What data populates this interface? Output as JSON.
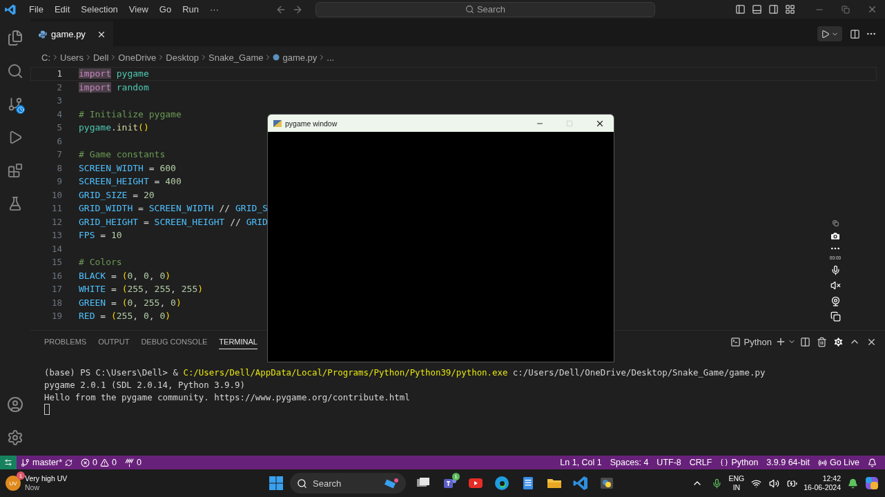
{
  "title_bar": {
    "menu": [
      "File",
      "Edit",
      "Selection",
      "View",
      "Go",
      "Run",
      "···"
    ],
    "search": {
      "placeholder": "Search"
    }
  },
  "editor_tabs": [
    {
      "label": "game.py",
      "selected": true
    }
  ],
  "breadcrumbs": [
    {
      "kind": "folder",
      "label": "C:"
    },
    {
      "kind": "folder",
      "label": "Users"
    },
    {
      "kind": "folder",
      "label": "Dell"
    },
    {
      "kind": "folder",
      "label": "OneDrive"
    },
    {
      "kind": "folder",
      "label": "Desktop"
    },
    {
      "kind": "folder",
      "label": "Snake_Game"
    },
    {
      "kind": "file",
      "label": "game.py"
    },
    {
      "kind": "more",
      "label": "..."
    }
  ],
  "code_lines": [
    {
      "number": "1",
      "current": true,
      "tokens": [
        {
          "kind": "keyword-match",
          "text": "import"
        },
        {
          "kind": "module",
          "text": " pygame"
        }
      ]
    },
    {
      "number": "2",
      "current": false,
      "tokens": [
        {
          "kind": "keyword-match",
          "text": "import"
        },
        {
          "kind": "module",
          "text": " random"
        }
      ]
    },
    {
      "number": "3",
      "current": false
    },
    {
      "number": "4",
      "current": false,
      "tokens": [
        {
          "kind": "comment",
          "text": "# Initialize pygame"
        }
      ]
    },
    {
      "number": "5",
      "current": false,
      "tokens": [
        {
          "kind": "module",
          "text": "pygame"
        },
        {
          "kind": "plain",
          "text": "."
        },
        {
          "kind": "function",
          "text": "init"
        },
        {
          "kind": "paren",
          "text": "()"
        }
      ]
    },
    {
      "number": "6",
      "current": false
    },
    {
      "number": "7",
      "current": false,
      "tokens": [
        {
          "kind": "comment",
          "text": "# Game constants"
        }
      ]
    },
    {
      "number": "8",
      "current": false,
      "tokens": [
        {
          "kind": "constant",
          "text": "SCREEN_WIDTH"
        },
        {
          "kind": "plain",
          "text": " = "
        },
        {
          "kind": "number",
          "text": "600"
        }
      ]
    },
    {
      "number": "9",
      "current": false,
      "tokens": [
        {
          "kind": "constant",
          "text": "SCREEN_HEIGHT"
        },
        {
          "kind": "plain",
          "text": " = "
        },
        {
          "kind": "number",
          "text": "400"
        }
      ]
    },
    {
      "number": "10",
      "current": false,
      "tokens": [
        {
          "kind": "constant",
          "text": "GRID_SIZE"
        },
        {
          "kind": "plain",
          "text": " = "
        },
        {
          "kind": "number",
          "text": "20"
        }
      ]
    },
    {
      "number": "11",
      "current": false,
      "tokens": [
        {
          "kind": "constant",
          "text": "GRID_WIDTH"
        },
        {
          "kind": "plain",
          "text": " = "
        },
        {
          "kind": "constant",
          "text": "SCREEN_WIDTH"
        },
        {
          "kind": "plain",
          "text": " // "
        },
        {
          "kind": "constant",
          "text": "GRID_S"
        }
      ]
    },
    {
      "number": "12",
      "current": false,
      "tokens": [
        {
          "kind": "constant",
          "text": "GRID_HEIGHT"
        },
        {
          "kind": "plain",
          "text": " = "
        },
        {
          "kind": "constant",
          "text": "SCREEN_HEIGHT"
        },
        {
          "kind": "plain",
          "text": " // "
        },
        {
          "kind": "constant",
          "text": "GRID"
        }
      ]
    },
    {
      "number": "13",
      "current": false,
      "tokens": [
        {
          "kind": "constant",
          "text": "FPS"
        },
        {
          "kind": "plain",
          "text": " = "
        },
        {
          "kind": "number",
          "text": "10"
        }
      ]
    },
    {
      "number": "14",
      "current": false
    },
    {
      "number": "15",
      "current": false,
      "tokens": [
        {
          "kind": "comment",
          "text": "# Colors"
        }
      ]
    },
    {
      "number": "16",
      "current": false,
      "tokens": [
        {
          "kind": "constant",
          "text": "BLACK"
        },
        {
          "kind": "plain",
          "text": " = "
        },
        {
          "kind": "paren",
          "text": "("
        },
        {
          "kind": "number",
          "text": "0"
        },
        {
          "kind": "plain",
          "text": ", "
        },
        {
          "kind": "number",
          "text": "0"
        },
        {
          "kind": "plain",
          "text": ", "
        },
        {
          "kind": "number",
          "text": "0"
        },
        {
          "kind": "paren",
          "text": ")"
        }
      ]
    },
    {
      "number": "17",
      "current": false,
      "tokens": [
        {
          "kind": "constant",
          "text": "WHITE"
        },
        {
          "kind": "plain",
          "text": " = "
        },
        {
          "kind": "paren",
          "text": "("
        },
        {
          "kind": "number",
          "text": "255"
        },
        {
          "kind": "plain",
          "text": ", "
        },
        {
          "kind": "number",
          "text": "255"
        },
        {
          "kind": "plain",
          "text": ", "
        },
        {
          "kind": "number",
          "text": "255"
        },
        {
          "kind": "paren",
          "text": ")"
        }
      ]
    },
    {
      "number": "18",
      "current": false,
      "tokens": [
        {
          "kind": "constant",
          "text": "GREEN"
        },
        {
          "kind": "plain",
          "text": " = "
        },
        {
          "kind": "paren",
          "text": "("
        },
        {
          "kind": "number",
          "text": "0"
        },
        {
          "kind": "plain",
          "text": ", "
        },
        {
          "kind": "number",
          "text": "255"
        },
        {
          "kind": "plain",
          "text": ", "
        },
        {
          "kind": "number",
          "text": "0"
        },
        {
          "kind": "paren",
          "text": ")"
        }
      ]
    },
    {
      "number": "19",
      "current": false,
      "tokens": [
        {
          "kind": "constant",
          "text": "RED"
        },
        {
          "kind": "plain",
          "text": " = "
        },
        {
          "kind": "paren",
          "text": "("
        },
        {
          "kind": "number",
          "text": "255"
        },
        {
          "kind": "plain",
          "text": ", "
        },
        {
          "kind": "number",
          "text": "0"
        },
        {
          "kind": "plain",
          "text": ", "
        },
        {
          "kind": "number",
          "text": "0"
        },
        {
          "kind": "paren",
          "text": ")"
        }
      ]
    }
  ],
  "panel": {
    "tabs": [
      {
        "label": "PROBLEMS",
        "selected": false
      },
      {
        "label": "OUTPUT",
        "selected": false
      },
      {
        "label": "DEBUG CONSOLE",
        "selected": false
      },
      {
        "label": "TERMINAL",
        "selected": true
      }
    ],
    "terminal_profile": "Python",
    "terminal_lines": [
      [
        {
          "kind": "plain",
          "text": "(base) PS C:\\Users\\Dell> & "
        },
        {
          "kind": "command",
          "text": "C:/Users/Dell/AppData/Local/Programs/Python/Python39/python.exe"
        },
        {
          "kind": "plain",
          "text": " c:/Users/Dell/OneDrive/Desktop/Snake_Game/game.py"
        }
      ],
      [
        {
          "kind": "plain",
          "text": "pygame 2.0.1 (SDL 2.0.14, Python 3.9.9)"
        }
      ],
      [
        {
          "kind": "plain",
          "text": "Hello from the pygame community. https://www.pygame.org/contribute.html"
        }
      ]
    ]
  },
  "pygame_window": {
    "title": "pygame window",
    "maximize_disabled": true
  },
  "recorder": {
    "timer": "00:00"
  },
  "status_bar": {
    "branch": "master*",
    "errors": "0",
    "warnings": "0",
    "ports": "0",
    "position": "Ln 1, Col 1",
    "indentation": "Spaces: 4",
    "encoding": "UTF-8",
    "line_ending": "CRLF",
    "language": "Python",
    "interpreter": "3.9.9 64-bit",
    "live_server": "Go Live"
  },
  "taskbar": {
    "weather": {
      "icon_text": "UV",
      "badge": "1",
      "title": "Very high UV",
      "subtitle": "Now"
    },
    "search": {
      "placeholder": "Search"
    },
    "teams_badge": "1",
    "language": {
      "line1": "ENG",
      "line2": "IN"
    },
    "clock": {
      "time": "12:42",
      "date": "16-06-2024"
    }
  }
}
